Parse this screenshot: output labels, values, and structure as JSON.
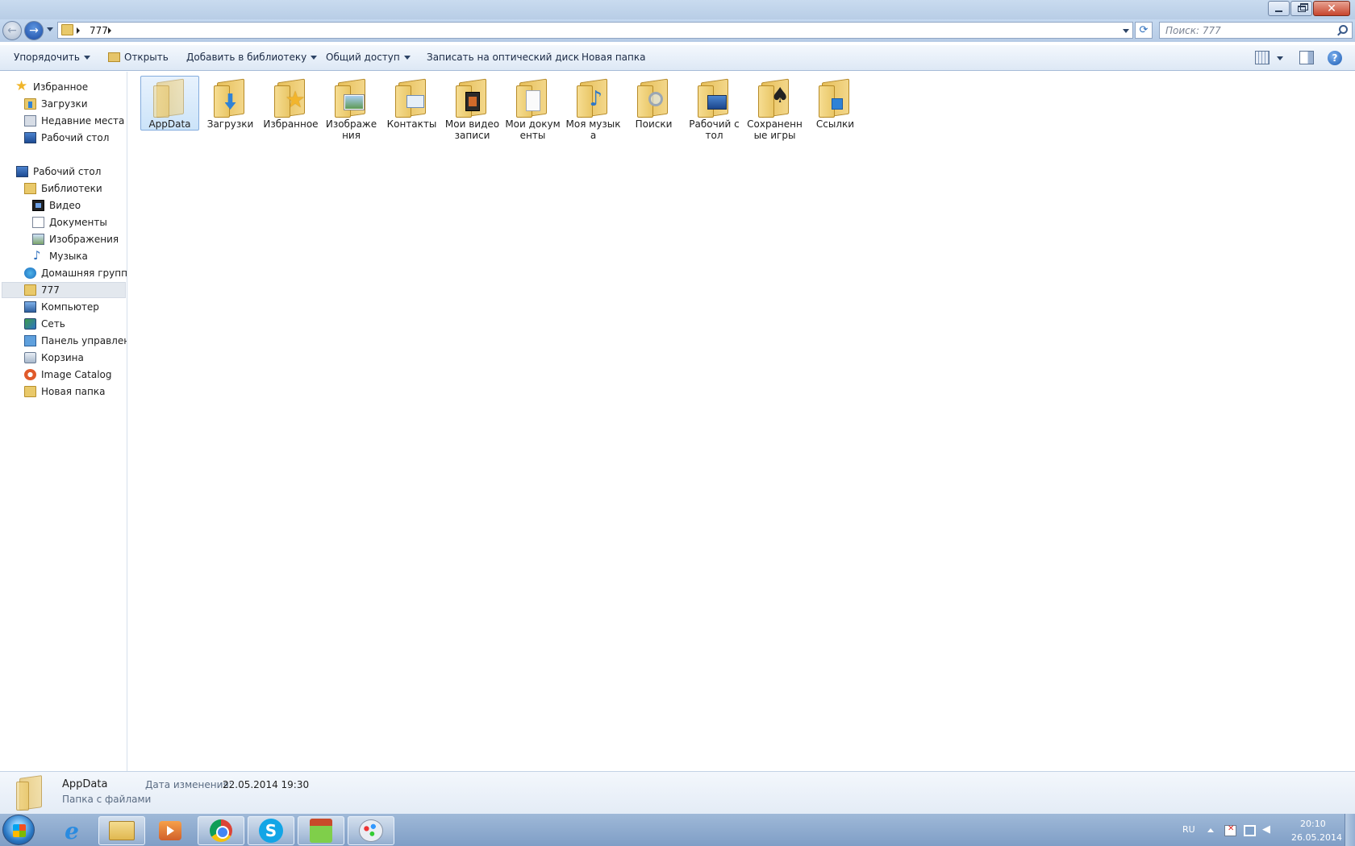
{
  "window": {
    "controls": {
      "minimize_icon": "minimize-icon",
      "maximize_icon": "restore-icon",
      "close_icon": "close-icon"
    }
  },
  "address": {
    "crumbs": [
      "777"
    ],
    "search_placeholder": "Поиск: 777"
  },
  "toolbar": {
    "organize": "Упорядочить",
    "open": "Открыть",
    "add_to_library": "Добавить в библиотеку",
    "share": "Общий доступ",
    "burn": "Записать на оптический диск",
    "new_folder": "Новая папка"
  },
  "sidebar": {
    "favorites": {
      "label": "Избранное",
      "items": [
        "Загрузки",
        "Недавние места",
        "Рабочий стол"
      ]
    },
    "desktop_label": "Рабочий стол",
    "libraries": {
      "label": "Библиотеки",
      "items": [
        "Видео",
        "Документы",
        "Изображения",
        "Музыка"
      ]
    },
    "root_items": [
      "Домашняя группа",
      "777",
      "Компьютер",
      "Сеть",
      "Панель управления",
      "Корзина",
      "Image Catalog",
      "Новая папка"
    ],
    "selected_item": "777"
  },
  "files": [
    {
      "name": "AppData",
      "icon": "hidden-folder-icon",
      "selected": true
    },
    {
      "name": "Загрузки",
      "icon": "downloads-folder-icon"
    },
    {
      "name": "Избранное",
      "icon": "favorites-folder-icon"
    },
    {
      "name": "Изображения",
      "icon": "pictures-folder-icon"
    },
    {
      "name": "Контакты",
      "icon": "contacts-folder-icon"
    },
    {
      "name": "Мои видеозаписи",
      "icon": "videos-folder-icon"
    },
    {
      "name": "Мои документы",
      "icon": "documents-folder-icon"
    },
    {
      "name": "Моя музыка",
      "icon": "music-folder-icon"
    },
    {
      "name": "Поиски",
      "icon": "searches-folder-icon"
    },
    {
      "name": "Рабочий стол",
      "icon": "desktop-folder-icon"
    },
    {
      "name": "Сохраненные игры",
      "icon": "saved-games-folder-icon"
    },
    {
      "name": "Ссылки",
      "icon": "links-folder-icon"
    }
  ],
  "details": {
    "name": "AppData",
    "type": "Папка с файлами",
    "modified_label": "Дата изменения:",
    "modified_value": "22.05.2014 19:30"
  },
  "taskbar": {
    "apps": [
      {
        "name": "Internet Explorer",
        "icon": "ie-icon",
        "running": false
      },
      {
        "name": "Проводник",
        "icon": "explorer-icon",
        "running": true
      },
      {
        "name": "Media Player",
        "icon": "media-player-icon",
        "running": false
      },
      {
        "name": "Google Chrome",
        "icon": "chrome-icon",
        "running": true
      },
      {
        "name": "Skype",
        "icon": "skype-icon",
        "running": true
      },
      {
        "name": "Game",
        "icon": "game-icon",
        "running": true
      },
      {
        "name": "Paint",
        "icon": "paint-icon",
        "running": true
      }
    ],
    "language": "RU",
    "time": "20:10",
    "date": "26.05.2014"
  }
}
